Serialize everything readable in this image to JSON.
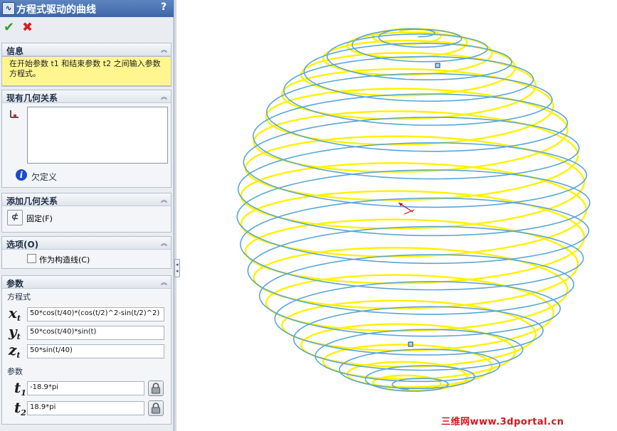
{
  "panel": {
    "title": "方程式驱动的曲线",
    "help": "?",
    "ok_icon": "checkmark-icon",
    "cancel_icon": "cross-icon"
  },
  "info": {
    "header": "信息",
    "message": "在开始参数 t1 和结束参数 t2 之间输入参数方程式。"
  },
  "existing_relations": {
    "header": "现有几何关系",
    "status": "欠定义"
  },
  "add_relations": {
    "header": "添加几何关系",
    "fix_label": "固定(F)"
  },
  "options": {
    "header": "选项(O)",
    "construction_label": "作为构造线(C)",
    "construction_checked": false
  },
  "params": {
    "header": "参数",
    "equation_label": "方程式",
    "x_var": "x",
    "y_var": "y",
    "z_var": "z",
    "sub_t": "t",
    "x_eq": "50*cos(t/40)*(cos(t/2)^2-sin(t/2)^2)",
    "y_eq": "50*cos(t/40)*sin(t)",
    "z_eq": "50*sin(t/40)",
    "param_label": "参数",
    "t_var": "t",
    "t1_sub": "1",
    "t2_sub": "2",
    "t1": "-18.9*pi",
    "t2": "18.9*pi"
  },
  "watermark": "三维网www.3dportal.cn",
  "colors": {
    "title_bar": "#3d66a8",
    "info_bg": "#fff68f",
    "curve_blue": "#5aa6d6",
    "curve_yellow": "#fff200"
  }
}
